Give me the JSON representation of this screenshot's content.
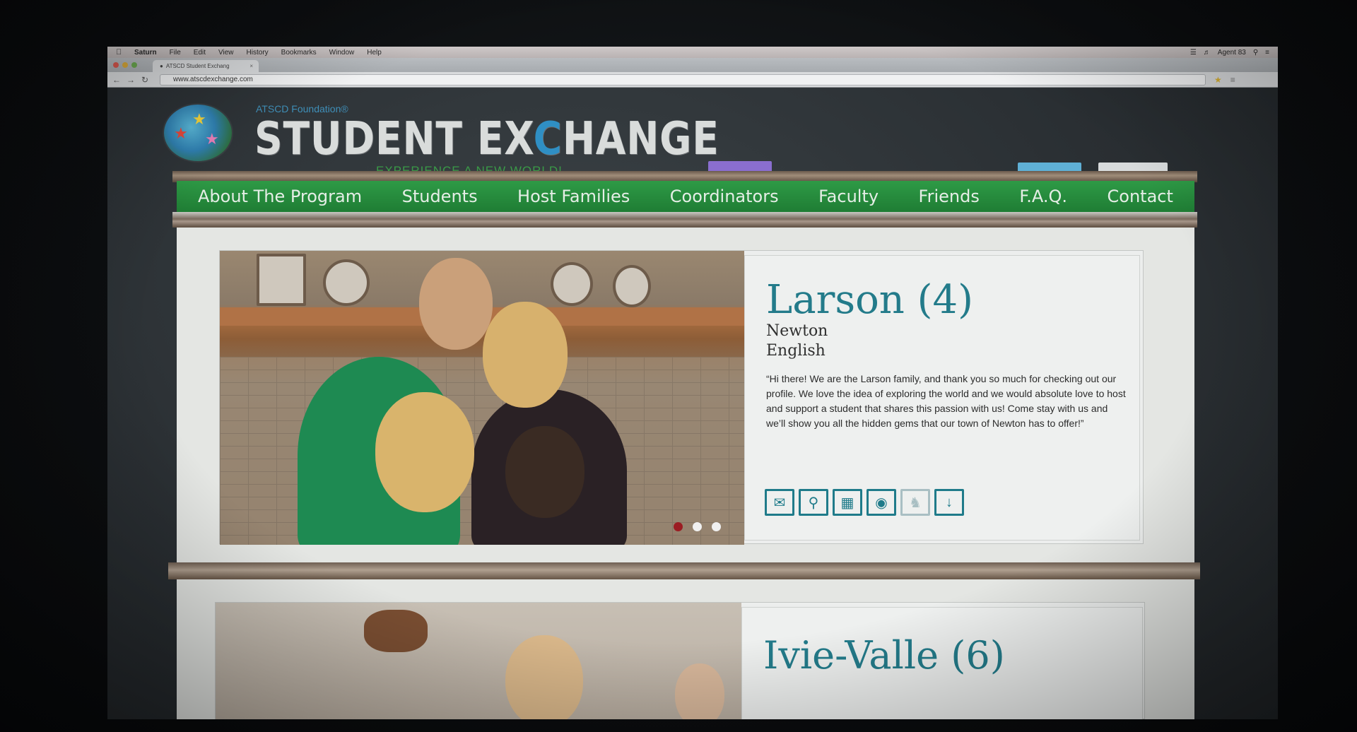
{
  "menubar": {
    "app": "Saturn",
    "items": [
      "File",
      "Edit",
      "View",
      "History",
      "Bookmarks",
      "Window",
      "Help"
    ],
    "status": "Agent 83"
  },
  "browser": {
    "tab_title": "ATSCD Student Exchang",
    "url": "www.atscdexchange.com"
  },
  "site": {
    "foundation": "ATSCD Foundation®",
    "title_pre": "STUDENT EX",
    "title_c": "C",
    "title_post": "HANGE",
    "tagline": "EXPERIENCE A NEW WORLD!",
    "nav": [
      "About The Program",
      "Students",
      "Host Families",
      "Coordinators",
      "Faculty",
      "Friends",
      "F.A.Q.",
      "Contact"
    ]
  },
  "family1": {
    "name": "Larson (4)",
    "town": "Newton",
    "language": "English",
    "quote": "“Hi there! We are the Larson family, and thank you so much for checking out our profile. We love the idea of exploring the world and we would absolute love to host and support a student that shares this passion with us! Come stay with us and we’ll show you all the hidden gems that our town of Newton has to offer!”",
    "icons": [
      "mail-icon",
      "location-pin-icon",
      "calendar-icon",
      "camera-icon",
      "dog-icon",
      "download-icon"
    ]
  },
  "family2": {
    "name": "Ivie-Valle (6)"
  },
  "colors": {
    "nav_green": "#2e9a46",
    "teal": "#237b8a",
    "accent_red": "#9b1c22"
  }
}
